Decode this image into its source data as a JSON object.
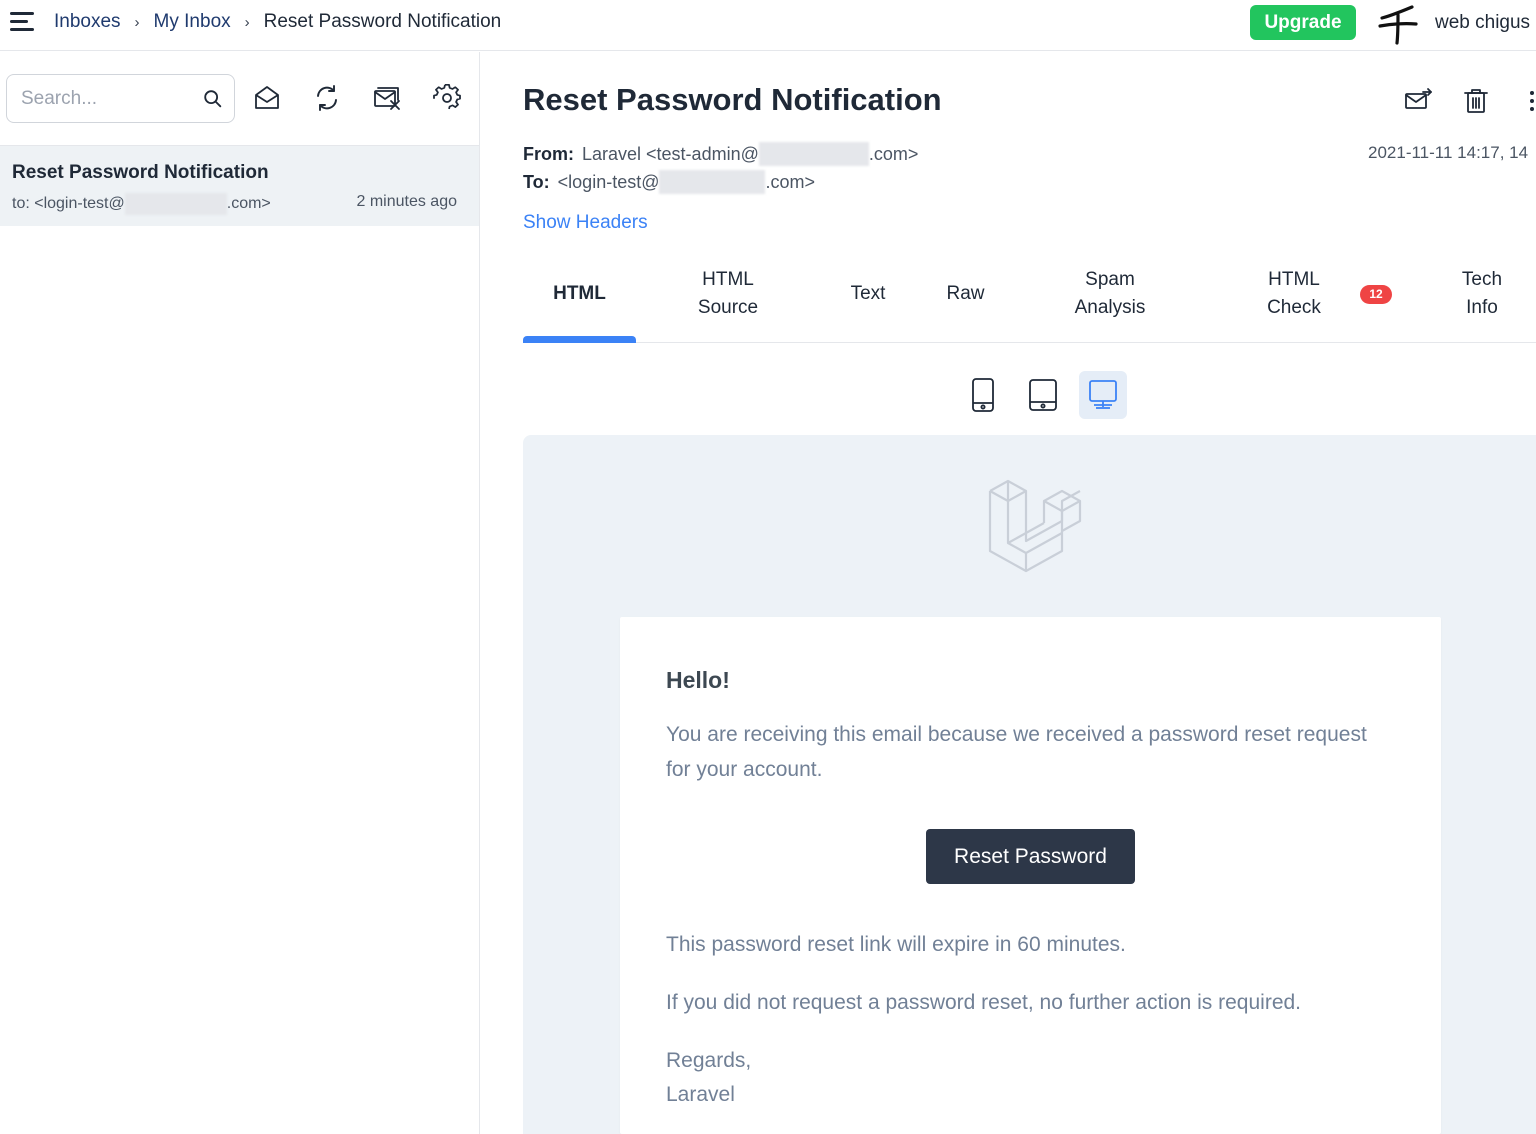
{
  "breadcrumb": {
    "items": [
      "Inboxes",
      "My Inbox",
      "Reset Password Notification"
    ],
    "separator": "›"
  },
  "header": {
    "upgrade_label": "Upgrade",
    "username": "web chigus"
  },
  "sidebar": {
    "search_placeholder": "Search...",
    "messages": [
      {
        "subject": "Reset Password Notification",
        "to_prefix": "to: <login-test@",
        "to_suffix": ".com>",
        "time": "2 minutes ago"
      }
    ]
  },
  "email": {
    "subject": "Reset Password Notification",
    "from_label": "From:",
    "from_prefix": "Laravel <test-admin@",
    "from_suffix": ".com>",
    "to_label": "To:",
    "to_prefix": "<login-test@",
    "to_suffix": ".com>",
    "date": "2021-11-11 14:17, 14",
    "show_headers": "Show Headers"
  },
  "tabs": [
    {
      "line1": "HTML",
      "line2": ""
    },
    {
      "line1": "HTML",
      "line2": "Source"
    },
    {
      "line1": "Text",
      "line2": ""
    },
    {
      "line1": "Raw",
      "line2": ""
    },
    {
      "line1": "Spam",
      "line2": "Analysis"
    },
    {
      "line1": "HTML",
      "line2": "Check"
    },
    {
      "line1": "Tech",
      "line2": "Info"
    }
  ],
  "html_check_badge": "12",
  "preview": {
    "greeting": "Hello!",
    "intro": "You are receiving this email because we received a password reset request for your account.",
    "button_label": "Reset Password",
    "expire": "This password reset link will expire in 60 minutes.",
    "no_action": "If you did not request a password reset, no further action is required.",
    "regards": "Regards,",
    "signature": "Laravel"
  },
  "colors": {
    "accent": "#3b82f6",
    "upgrade": "#22c55e",
    "badge": "#ef4444",
    "button_dark": "#2d3748",
    "preview_bg": "#edf2f7"
  }
}
